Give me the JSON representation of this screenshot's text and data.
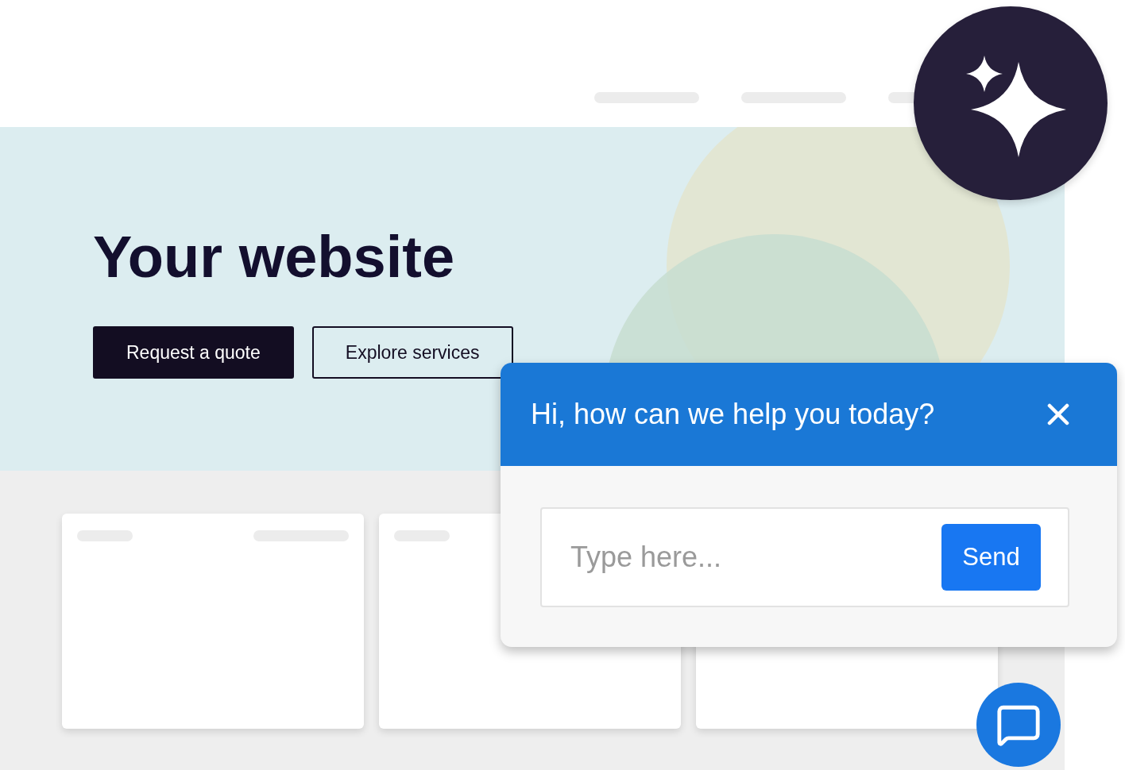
{
  "hero": {
    "title": "Your website",
    "buttons": [
      {
        "label": "Request a quote",
        "kind": "primary"
      },
      {
        "label": "Explore services",
        "kind": "outline"
      }
    ]
  },
  "chat": {
    "title": "Hi, how can we help you today?",
    "input": {
      "placeholder": "Type here..."
    },
    "send_button": "Send"
  }
}
